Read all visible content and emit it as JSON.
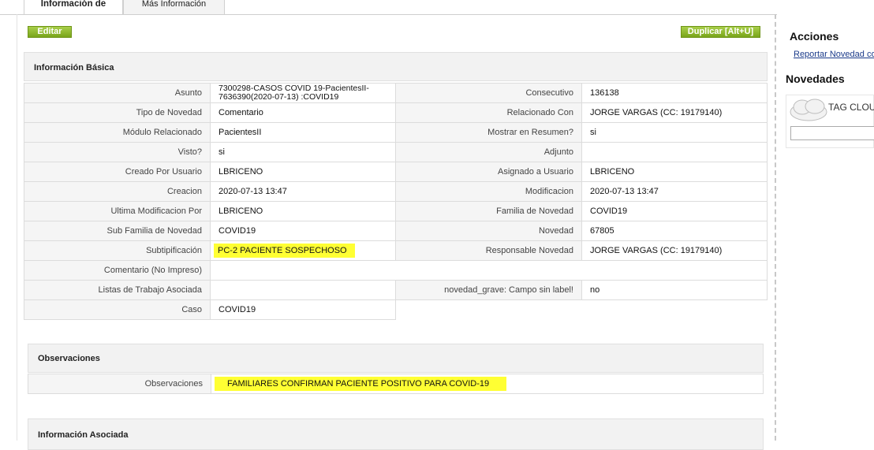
{
  "tabs": [
    {
      "label": "Información de"
    },
    {
      "label": "Más Información"
    }
  ],
  "buttons": {
    "edit": "Editar",
    "duplicate": "Duplicar [Alt+U]"
  },
  "basic": {
    "title": "Información Básica",
    "rows": [
      {
        "l1": "Asunto",
        "v1": "7300298-CASOS COVID 19-PacientesII-7636390(2020-07-13) :COVID19",
        "l2": "Consecutivo",
        "v2": "136138"
      },
      {
        "l1": "Tipo de Novedad",
        "v1": "Comentario",
        "l2": "Relacionado Con",
        "v2": "JORGE VARGAS (CC: 19179140)"
      },
      {
        "l1": "Módulo Relacionado",
        "v1": "PacientesII",
        "l2": "Mostrar en Resumen?",
        "v2": "si"
      },
      {
        "l1": "Visto?",
        "v1": "si",
        "l2": "Adjunto",
        "v2": ""
      },
      {
        "l1": "Creado Por Usuario",
        "v1": "LBRICENO",
        "l2": "Asignado a Usuario",
        "v2": "LBRICENO"
      },
      {
        "l1": "Creacion",
        "v1": "2020-07-13 13:47",
        "l2": "Modificacion",
        "v2": "2020-07-13 13:47"
      },
      {
        "l1": "Ultima Modificacion Por",
        "v1": "LBRICENO",
        "l2": "Familia de Novedad",
        "v2": "COVID19"
      },
      {
        "l1": "Sub Familia de Novedad",
        "v1": "COVID19",
        "l2": "Novedad",
        "v2": "67805"
      },
      {
        "l1": "Subtipificación",
        "v1": "PC-2 PACIENTE SOSPECHOSO",
        "l2": "Responsable Novedad",
        "v2": "JORGE VARGAS (CC: 19179140)"
      },
      {
        "l1": "Comentario (No Impreso)",
        "v1": ""
      },
      {
        "l1": "Listas de Trabajo Asociada",
        "v1": "",
        "l2": "novedad_grave: Campo sin label!",
        "v2": "no"
      },
      {
        "l1": "Caso",
        "v1": "COVID19"
      }
    ]
  },
  "observaciones": {
    "title": "Observaciones",
    "label": "Observaciones",
    "value": "FAMILIARES CONFIRMAN PACIENTE POSITIVO PARA COVID-19"
  },
  "asociada": {
    "title": "Información Asociada"
  },
  "sidebar": {
    "acciones": "Acciones",
    "report_link": "Reportar Novedad con",
    "novedades": "Novedades",
    "tag_label": "TAG CLOUD",
    "tag_input": ""
  }
}
